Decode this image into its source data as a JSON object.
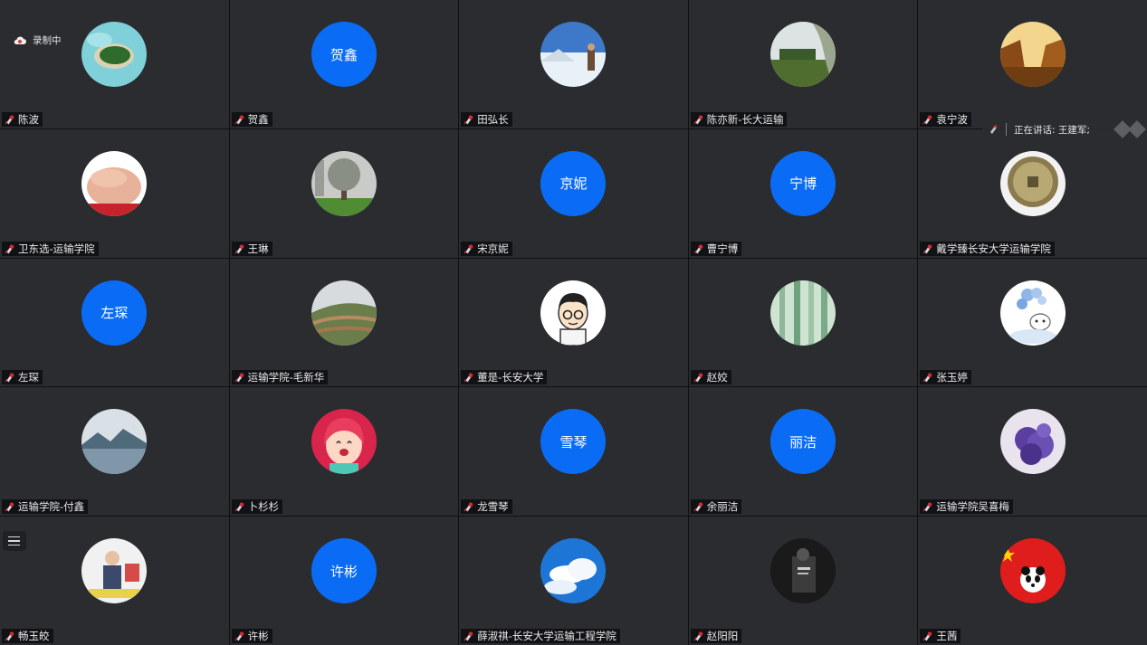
{
  "recording_label": "录制中",
  "speaking_label": "正在讲话: 王建军;",
  "colors": {
    "avatar_blue": "#0a6cf5",
    "tile_bg": "#2a2c30",
    "mic_red": "#d62b35"
  },
  "participants": [
    {
      "name": "陈波",
      "avatar": "island-photo"
    },
    {
      "name": "贺鑫",
      "avatar_text": "贺鑫"
    },
    {
      "name": "田弘长",
      "avatar": "snow-person-photo"
    },
    {
      "name": "陈亦新-长大运输",
      "avatar": "willow-photo"
    },
    {
      "name": "袁宁波",
      "avatar": "canyon-photo"
    },
    {
      "name": "卫东选-运输学院",
      "avatar": "hands-photo"
    },
    {
      "name": "王琳",
      "avatar": "tree-photo"
    },
    {
      "name": "宋京妮",
      "avatar_text": "京妮"
    },
    {
      "name": "曹宁博",
      "avatar_text": "宁博"
    },
    {
      "name": "戴学臻长安大学运输学院",
      "avatar": "coin-photo"
    },
    {
      "name": "左琛",
      "avatar_text": "左琛"
    },
    {
      "name": "运输学院-毛新华",
      "avatar": "terraces-photo"
    },
    {
      "name": "董是-长安大学",
      "avatar": "cartoon-man"
    },
    {
      "name": "赵姣",
      "avatar": "bamboo-photo"
    },
    {
      "name": "张玉婷",
      "avatar": "cartoon-balloons"
    },
    {
      "name": "运输学院-付鑫",
      "avatar": "lake-photo"
    },
    {
      "name": "卜杉杉",
      "avatar": "cartoon-girl"
    },
    {
      "name": "龙雪琴",
      "avatar_text": "雪琴"
    },
    {
      "name": "余丽洁",
      "avatar_text": "丽洁"
    },
    {
      "name": "运输学院吴喜梅",
      "avatar": "lavender-photo"
    },
    {
      "name": "畅玉皎",
      "avatar": "child-photo"
    },
    {
      "name": "许彬",
      "avatar_text": "许彬"
    },
    {
      "name": "薛淑祺-长安大学运输工程学院",
      "avatar": "clouds-photo"
    },
    {
      "name": "赵阳阳",
      "avatar": "mono-photo"
    },
    {
      "name": "王茜",
      "avatar": "panda-flag"
    }
  ]
}
